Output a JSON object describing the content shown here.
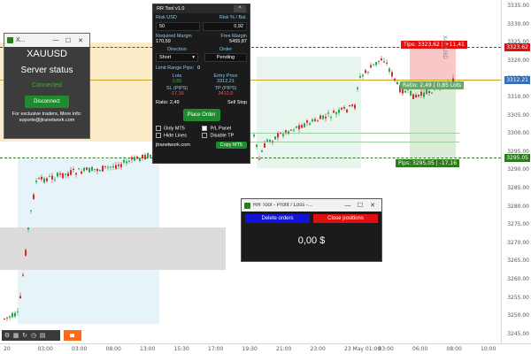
{
  "chart": {
    "symbol_vertical": "XAU/USD",
    "price_ticks": [
      "3335.00",
      "3330.00",
      "3325.00",
      "3320.00",
      "3315.00",
      "3310.00",
      "3305.00",
      "3300.00",
      "3295.00",
      "3290.00",
      "3285.00",
      "3280.00",
      "3275.00",
      "3270.00",
      "3265.00",
      "3260.00",
      "3255.00",
      "3250.00",
      "3245.00"
    ],
    "time_ticks": [
      "20",
      "03:00",
      "03:00",
      "08:00",
      "13:00",
      "15:30",
      "17:00",
      "19:30",
      "21:00",
      "23:00",
      "23 May 01:00",
      "03:00",
      "06:00",
      "08:00",
      "10:00"
    ],
    "tp_price_tag": "3323.62",
    "current_price_tag": "3312.21",
    "sl_price_tag": "3295.05",
    "tp_label": "Tips: 3323,62 | +11,41",
    "sl_label": "Pips: 3295,05 | -17,16",
    "ratio_label": "Ratio: 2,49 | 0,85 Lots",
    "tp_color": "#e01010",
    "sl_color": "#2d7a1f",
    "current_color": "#c9a227"
  },
  "server_window": {
    "title": "X...",
    "symbol": "XAUUSD",
    "status_title": "Server status",
    "status_value": "Connected",
    "disconnect_label": "Disconnect",
    "footer_line1": "For exclusive traders, More info:",
    "footer_line2": "soporte@jtranetwork.com"
  },
  "rr_tool": {
    "title": "RR Tool v1.0",
    "risk_usd_label": "Risk USD",
    "risk_pct_label": "Risk % / Bal.",
    "risk_usd_value": "50",
    "risk_pct_value": "0,92",
    "required_margin_label": "Required Margin",
    "free_margin_label": "Free Margin",
    "required_margin_value": "170,59",
    "free_margin_value": "5455,87",
    "direction_label": "Direction",
    "order_label": "Order",
    "direction_value": "Short",
    "order_value": "Pending",
    "limit_range_label": "Limit Range Pips:",
    "limit_range_value": "0",
    "lots_label": "Lots",
    "entry_label": "Entry Price",
    "lots_value": "0,85",
    "entry_value": "3312,21",
    "sl_label": "SL (PIPS)",
    "tp_label": "TP (PIPS)",
    "sl_value": "-17,16",
    "tp_value": "3412,0",
    "ratio_text": "Ratio: 2,49",
    "sell_stop_text": "Sell Stop",
    "place_order_label": "Place Order",
    "only_mt5_label": "Only MT5",
    "pl_panel_label": "P/L Panel",
    "hide_lines_label": "Hide Lines",
    "disable_tp_label": "Disable TP",
    "website": "jtranetwork.com",
    "copy_mt5_label": "Copy MT5"
  },
  "pl_window": {
    "title": "RR Tool - Profit / Loss -...",
    "delete_orders_label": "Delete orders",
    "close_positions_label": "Close positions",
    "value": "0,00 $"
  },
  "toolbar": {
    "icons": [
      "gear-icon",
      "grid-icon",
      "refresh-icon",
      "clock-icon",
      "chart-icon"
    ]
  }
}
